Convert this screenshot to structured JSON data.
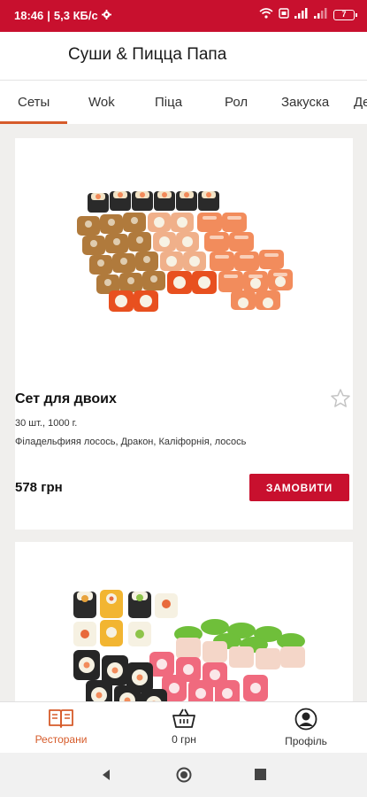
{
  "status_bar": {
    "time": "18:46",
    "speed": "5,3 КБ/с",
    "battery": "7"
  },
  "header": {
    "title": "Суши & Пицца Папа"
  },
  "tabs": [
    {
      "label": "Сеты",
      "active": true
    },
    {
      "label": "Wok",
      "active": false
    },
    {
      "label": "Піца",
      "active": false
    },
    {
      "label": "Рол",
      "active": false
    },
    {
      "label": "Закуска",
      "active": false
    },
    {
      "label": "Де",
      "active": false
    }
  ],
  "products": [
    {
      "title": "Сет для двоих",
      "weight": "30 шт., 1000 г.",
      "description": "Філадельфияя лосось, Дракон, Каліфорнія, лосось",
      "price": "578 грн",
      "order_label": "ЗАМОВИТИ",
      "image_icon": "sushi-set-image"
    },
    {
      "image_icon": "sushi-set-image"
    }
  ],
  "bottom_nav": {
    "restaurants": "Ресторани",
    "cart": "0 грн",
    "profile": "Профіль"
  },
  "colors": {
    "brand_red": "#c8102e",
    "accent_orange": "#d65b2a"
  }
}
